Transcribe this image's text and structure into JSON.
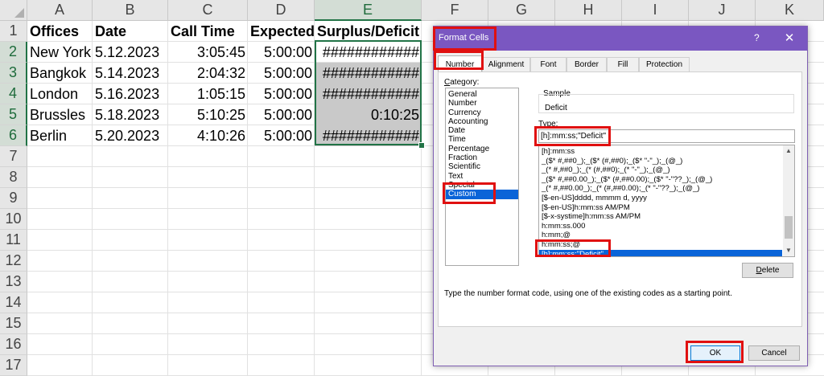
{
  "sheet": {
    "columns": [
      "A",
      "B",
      "C",
      "D",
      "E",
      "F",
      "G",
      "H",
      "I",
      "J",
      "K"
    ],
    "rows": [
      "1",
      "2",
      "3",
      "4",
      "5",
      "6",
      "7",
      "8",
      "9",
      "10",
      "11",
      "12",
      "13",
      "14",
      "15",
      "16",
      "17"
    ],
    "headers": [
      "Offices",
      "Date",
      "Call Time",
      "Expected",
      "Surplus/Deficit"
    ],
    "data": [
      [
        "New York",
        "5.12.2023",
        "3:05:45",
        "5:00:00",
        "############"
      ],
      [
        "Bangkok",
        "5.14.2023",
        "2:04:32",
        "5:00:00",
        "############"
      ],
      [
        "London",
        "5.16.2023",
        "1:05:15",
        "5:00:00",
        "############"
      ],
      [
        "Brussles",
        "5.18.2023",
        "5:10:25",
        "5:00:00",
        "0:10:25"
      ],
      [
        "Berlin",
        "5.20.2023",
        "4:10:26",
        "5:00:00",
        "############"
      ]
    ]
  },
  "dialog": {
    "title": "Format Cells",
    "help": "?",
    "close": "✕",
    "tabs": [
      "Number",
      "Alignment",
      "Font",
      "Border",
      "Fill",
      "Protection"
    ],
    "category_label_accel": "C",
    "category_label_rest": "ategory:",
    "categories": [
      "General",
      "Number",
      "Currency",
      "Accounting",
      "Date",
      "Time",
      "Percentage",
      "Fraction",
      "Scientific",
      "Text",
      "Special",
      "Custom"
    ],
    "sample_label": "Sample",
    "sample_value": "Deficit",
    "type_label_accel": "T",
    "type_label_rest": "ype:",
    "type_value": "[h]:mm:ss;\"Deficit\"",
    "format_codes": [
      "[h]:mm:ss",
      "_($* #,##0_);_($* (#,##0);_($* \"-\"_);_(@_)",
      "_(* #,##0_);_(* (#,##0);_(* \"-\"_);_(@_)",
      "_($* #,##0.00_);_($* (#,##0.00);_($* \"-\"??_);_(@_)",
      "_(* #,##0.00_);_(* (#,##0.00);_(* \"-\"??_);_(@_)",
      "[$-en-US]dddd, mmmm d, yyyy",
      "[$-en-US]h:mm:ss AM/PM",
      "[$-x-systime]h:mm:ss AM/PM",
      "h:mm:ss.000",
      "h:mm;@",
      "h:mm:ss;@",
      "[h]:mm:ss;\"Deficit\""
    ],
    "delete_label_accel": "D",
    "delete_label_rest": "elete",
    "hint": "Type the number format code, using one of the existing codes as a starting point.",
    "ok_label": "OK",
    "cancel_label": "Cancel"
  }
}
